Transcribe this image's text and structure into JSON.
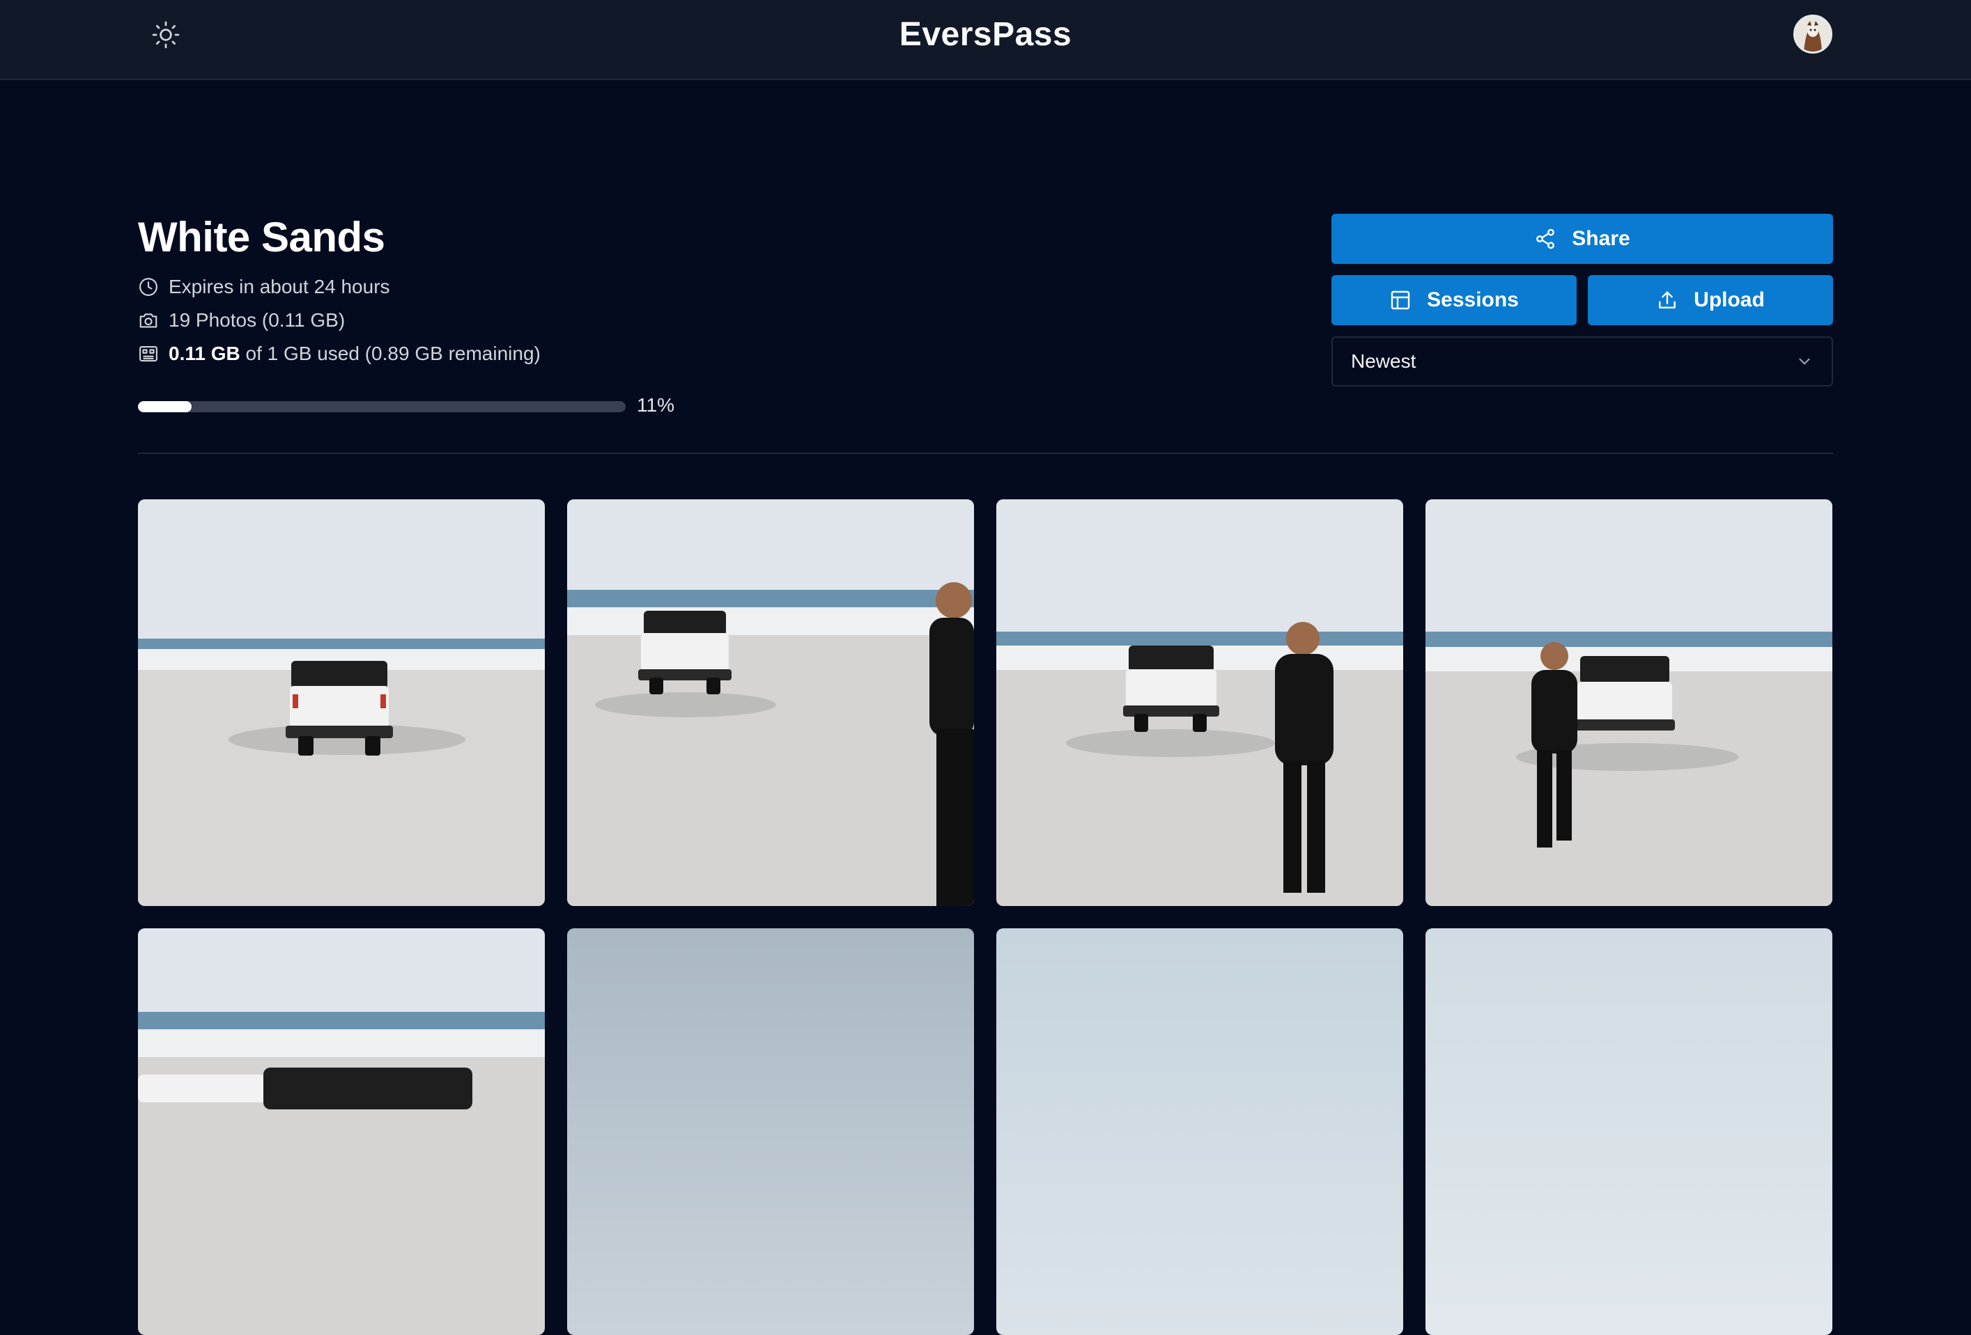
{
  "header": {
    "brand": "EversPass",
    "theme_icon": "sun-icon",
    "avatar_icon": "user-avatar"
  },
  "album": {
    "title": "White Sands",
    "expires": "Expires in about 24 hours",
    "photos": "19 Photos (0.11 GB)",
    "storage_used": "0.11 GB",
    "storage_rest": "of 1 GB used (0.89 GB remaining)",
    "usage_percent_label": "11%",
    "usage_fraction": 0.11
  },
  "actions": {
    "share_label": "Share",
    "sessions_label": "Sessions",
    "upload_label": "Upload",
    "sort_value": "Newest"
  },
  "colors": {
    "page_bg": "#040b1f",
    "header_bg": "#111827",
    "accent": "#0a7bd0"
  },
  "photos": [
    {
      "scene": "truck-rear"
    },
    {
      "scene": "truck-man-right-edge"
    },
    {
      "scene": "truck-man-standing"
    },
    {
      "scene": "man-walking-truck"
    },
    {
      "scene": "truck-side-partial"
    },
    {
      "scene": "sky"
    },
    {
      "scene": "sky"
    },
    {
      "scene": "sky"
    }
  ]
}
